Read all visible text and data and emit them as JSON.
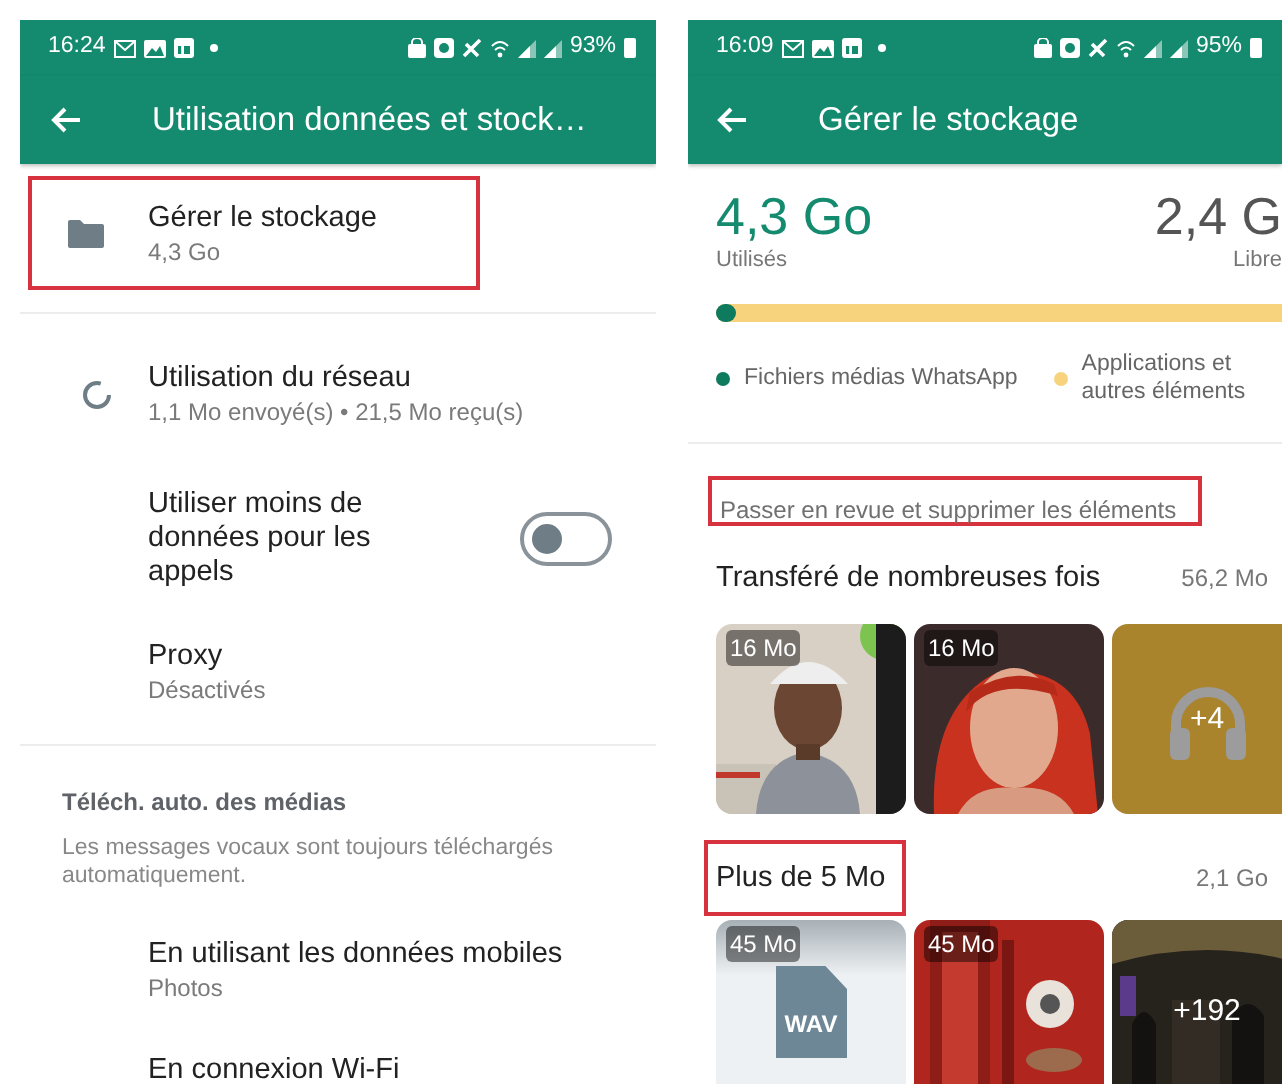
{
  "left_screen": {
    "status_bar": {
      "time": "16:24",
      "battery": "93%"
    },
    "title": "Utilisation données et stock…",
    "storage_item": {
      "title": "Gérer le stockage",
      "subtitle": "4,3 Go",
      "highlighted": true
    },
    "network_items": [
      {
        "kind": "icon",
        "title": "Utilisation du réseau",
        "subtitle": "1,1 Mo envoyé(s) • 21,5 Mo reçu(s)"
      },
      {
        "kind": "toggle",
        "title": "Utiliser moins de données pour les appels",
        "on": false
      },
      {
        "kind": "plain",
        "title": "Proxy",
        "subtitle": "Désactivés"
      }
    ],
    "media_section": {
      "heading": "Téléch. auto. des médias",
      "note": "Les messages vocaux sont toujours téléchargés automatiquement.",
      "items": [
        {
          "title": "En utilisant les données mobiles",
          "subtitle": "Photos"
        },
        {
          "title": "En connexion Wi-Fi"
        }
      ]
    }
  },
  "right_screen": {
    "status_bar": {
      "time": "16:09",
      "battery": "95%"
    },
    "title": "Gérer le stockage",
    "used": {
      "value": "4,3 Go",
      "label": "Utilisés"
    },
    "free": {
      "value": "2,4 G",
      "label": "Libre"
    },
    "storage_bar": {
      "level": 0.035
    },
    "legend": [
      {
        "label": "Fichiers médias WhatsApp",
        "color": "#0e7a5e"
      },
      {
        "label": "Applications et autres éléments",
        "color": "#f7d37e"
      }
    ],
    "review_heading": {
      "text": "Passer en revue et supprimer les éléments",
      "highlighted": true
    },
    "groups": [
      {
        "title": "Transféré de nombreuses fois",
        "size": "56,2 Mo",
        "highlighted": false,
        "tiles": [
          {
            "kind": "picture",
            "size": "16 Mo"
          },
          {
            "kind": "picture",
            "size": "16 Mo"
          },
          {
            "kind": "audio",
            "more": "+4"
          }
        ]
      },
      {
        "title": "Plus de 5 Mo",
        "size": "2,1 Go",
        "highlighted": true,
        "tiles": [
          {
            "kind": "file",
            "size": "45 Mo",
            "file_type": "WAV"
          },
          {
            "kind": "picture",
            "size": "45 Mo"
          },
          {
            "kind": "picture",
            "more": "+192"
          }
        ]
      }
    ]
  }
}
